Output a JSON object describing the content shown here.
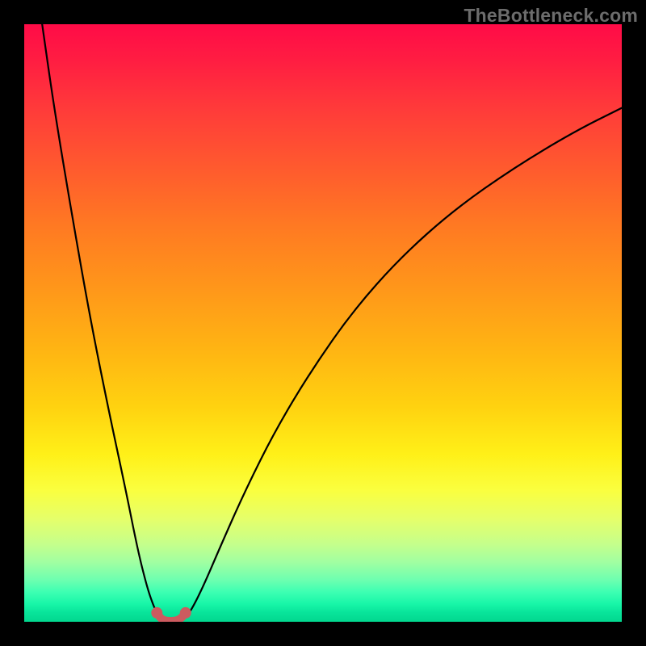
{
  "watermark": "TheBottleneck.com",
  "chart_data": {
    "type": "line",
    "title": "",
    "xlabel": "",
    "ylabel": "",
    "xlim": [
      0,
      100
    ],
    "ylim": [
      0,
      100
    ],
    "gradient_stops": [
      {
        "pos": 0,
        "color": "#ff0b47"
      },
      {
        "pos": 6,
        "color": "#ff1d42"
      },
      {
        "pos": 14,
        "color": "#ff3a3a"
      },
      {
        "pos": 24,
        "color": "#ff5a2e"
      },
      {
        "pos": 34,
        "color": "#ff7a22"
      },
      {
        "pos": 44,
        "color": "#ff961a"
      },
      {
        "pos": 54,
        "color": "#ffb313"
      },
      {
        "pos": 64,
        "color": "#ffd210"
      },
      {
        "pos": 72,
        "color": "#fff018"
      },
      {
        "pos": 78,
        "color": "#faff3f"
      },
      {
        "pos": 83,
        "color": "#e4ff6c"
      },
      {
        "pos": 87,
        "color": "#c5ff8b"
      },
      {
        "pos": 90,
        "color": "#a1ffa1"
      },
      {
        "pos": 93,
        "color": "#6dffb0"
      },
      {
        "pos": 95,
        "color": "#3dffb2"
      },
      {
        "pos": 97,
        "color": "#18f6a8"
      },
      {
        "pos": 98.5,
        "color": "#08e49a"
      },
      {
        "pos": 100,
        "color": "#02d78f"
      }
    ],
    "series": [
      {
        "name": "left-curve",
        "color": "#000000",
        "x": [
          3,
          5,
          8,
          11,
          14,
          17,
          19,
          20.5,
          21.5,
          22.2,
          22.8
        ],
        "y": [
          100,
          86,
          68,
          51,
          36,
          22,
          12,
          6,
          3,
          1.5,
          0.8
        ]
      },
      {
        "name": "right-curve",
        "color": "#000000",
        "x": [
          27,
          28,
          30,
          33,
          37,
          42,
          48,
          55,
          63,
          72,
          82,
          92,
          100
        ],
        "y": [
          0.8,
          2,
          6,
          13,
          22,
          32,
          42,
          52,
          61,
          69,
          76,
          82,
          86
        ]
      },
      {
        "name": "bottom-link",
        "color": "#cc5b5f",
        "x": [
          22.2,
          22.8,
          23.5,
          24.5,
          25.5,
          26.3,
          27
        ],
        "y": [
          1.5,
          0.6,
          0.2,
          0.1,
          0.2,
          0.6,
          1.5
        ]
      }
    ],
    "markers": [
      {
        "x": 22.2,
        "y": 1.5,
        "color": "#cc5b5f"
      },
      {
        "x": 27.0,
        "y": 1.5,
        "color": "#cc5b5f"
      }
    ]
  }
}
